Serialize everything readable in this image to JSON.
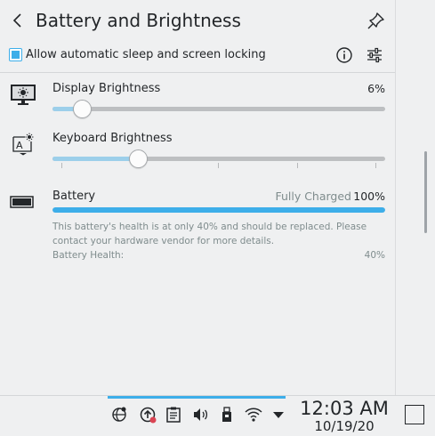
{
  "header": {
    "title": "Battery and Brightness",
    "inhibit_checkbox_label": "Allow automatic sleep and screen locking",
    "inhibit_checked": true
  },
  "display_brightness": {
    "label": "Display Brightness",
    "percent_text": "6%",
    "value_fraction": 0.09
  },
  "keyboard_brightness": {
    "label": "Keyboard Brightness",
    "value_fraction": 0.26
  },
  "battery": {
    "label": "Battery",
    "status": "Fully Charged",
    "percent_text": "100%",
    "charge_fraction": 1.0,
    "warning": "This battery's health is at only 40% and should be replaced. Please contact your hardware vendor for more details.",
    "health_label": "Battery Health:",
    "health_value": "40%"
  },
  "taskbar": {
    "clock_time": "12:03 AM",
    "clock_date": "10/19/20",
    "tray_icons": [
      "kde-connect-icon",
      "updates-icon",
      "clipboard-icon",
      "volume-icon",
      "usb-device-icon",
      "wifi-icon",
      "expand-tray-icon"
    ]
  },
  "colors": {
    "accent": "#3daee9",
    "accent_light": "#9ccfea",
    "background": "#eff0f1",
    "text": "#232629",
    "muted_text": "#7f8c8d"
  }
}
